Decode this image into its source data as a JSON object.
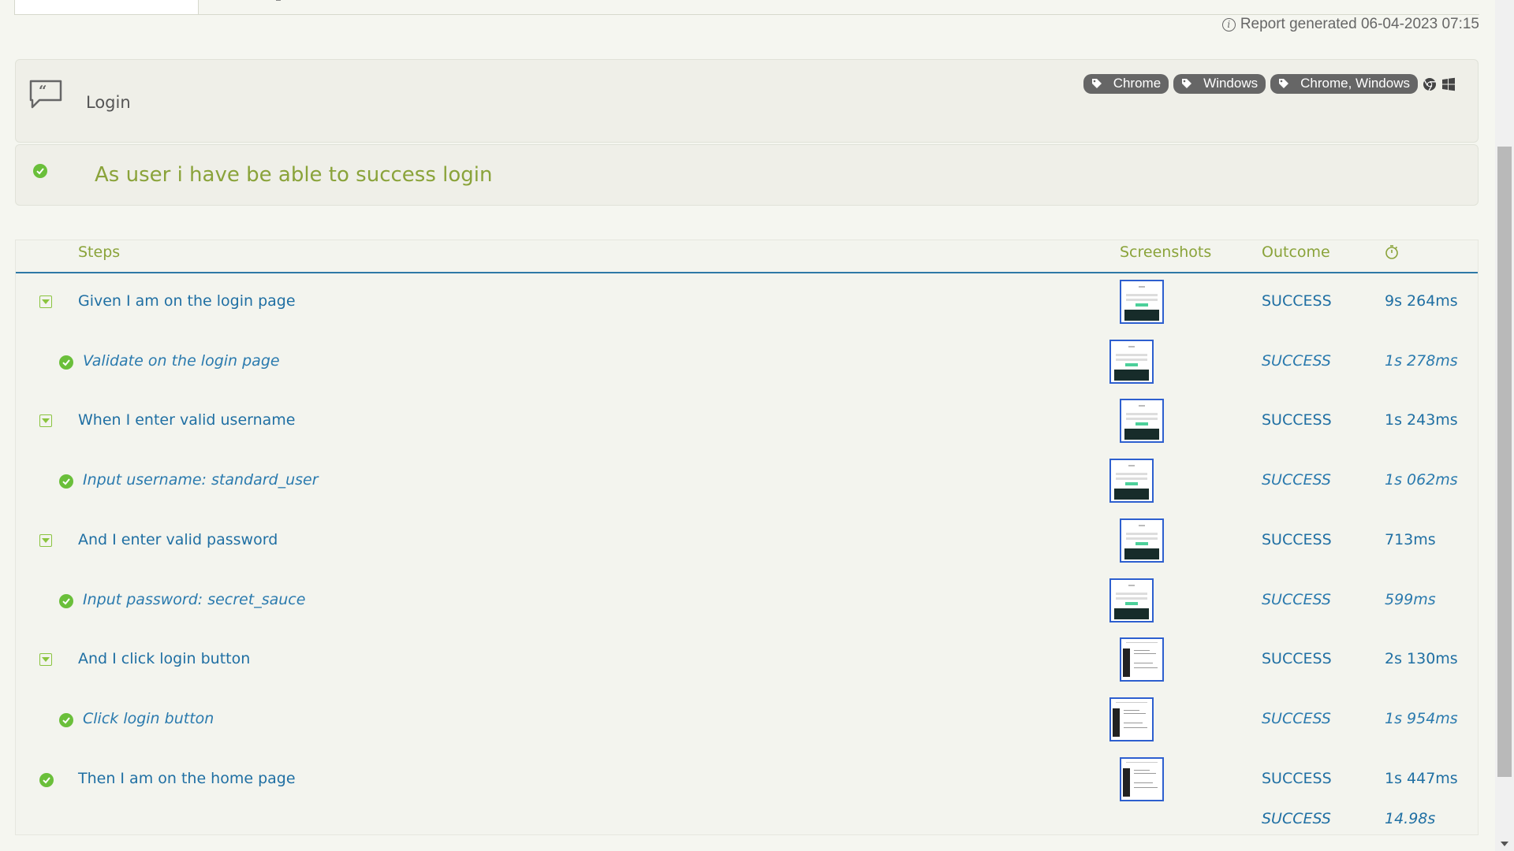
{
  "report": {
    "generated_label": "Report generated 06-04-2023 07:15"
  },
  "feature": {
    "title": "Login",
    "tags": [
      "Chrome",
      "Windows",
      "Chrome, Windows"
    ],
    "icons": [
      "chrome-icon",
      "windows-icon"
    ]
  },
  "scenario": {
    "title": "As user i have be able to success login",
    "status": "passed"
  },
  "table": {
    "headers": {
      "steps": "Steps",
      "screenshots": "Screenshots",
      "outcome": "Outcome",
      "duration_icon": "stopwatch-icon"
    },
    "rows": [
      {
        "type": "step",
        "text": "Given I am on the login page",
        "outcome": "SUCCESS",
        "duration": "9s 264ms",
        "thumb": "login"
      },
      {
        "type": "sub",
        "text": "Validate on the login page",
        "outcome": "SUCCESS",
        "duration": "1s 278ms",
        "thumb": "login"
      },
      {
        "type": "step",
        "text": "When I enter valid username",
        "outcome": "SUCCESS",
        "duration": "1s 243ms",
        "thumb": "login"
      },
      {
        "type": "sub",
        "text": "Input username: standard_user",
        "outcome": "SUCCESS",
        "duration": "1s 062ms",
        "thumb": "login"
      },
      {
        "type": "step",
        "text": "And I enter valid password",
        "outcome": "SUCCESS",
        "duration": "713ms",
        "thumb": "login"
      },
      {
        "type": "sub",
        "text": "Input password: secret_sauce",
        "outcome": "SUCCESS",
        "duration": "599ms",
        "thumb": "login"
      },
      {
        "type": "step",
        "text": "And I click login button",
        "outcome": "SUCCESS",
        "duration": "2s 130ms",
        "thumb": "home"
      },
      {
        "type": "sub",
        "text": "Click login button",
        "outcome": "SUCCESS",
        "duration": "1s 954ms",
        "thumb": "home"
      },
      {
        "type": "final",
        "text": "Then I am on the home page",
        "outcome": "SUCCESS",
        "duration": "1s 447ms",
        "thumb": "home"
      }
    ],
    "total": {
      "outcome": "SUCCESS",
      "duration": "14.98s"
    }
  }
}
